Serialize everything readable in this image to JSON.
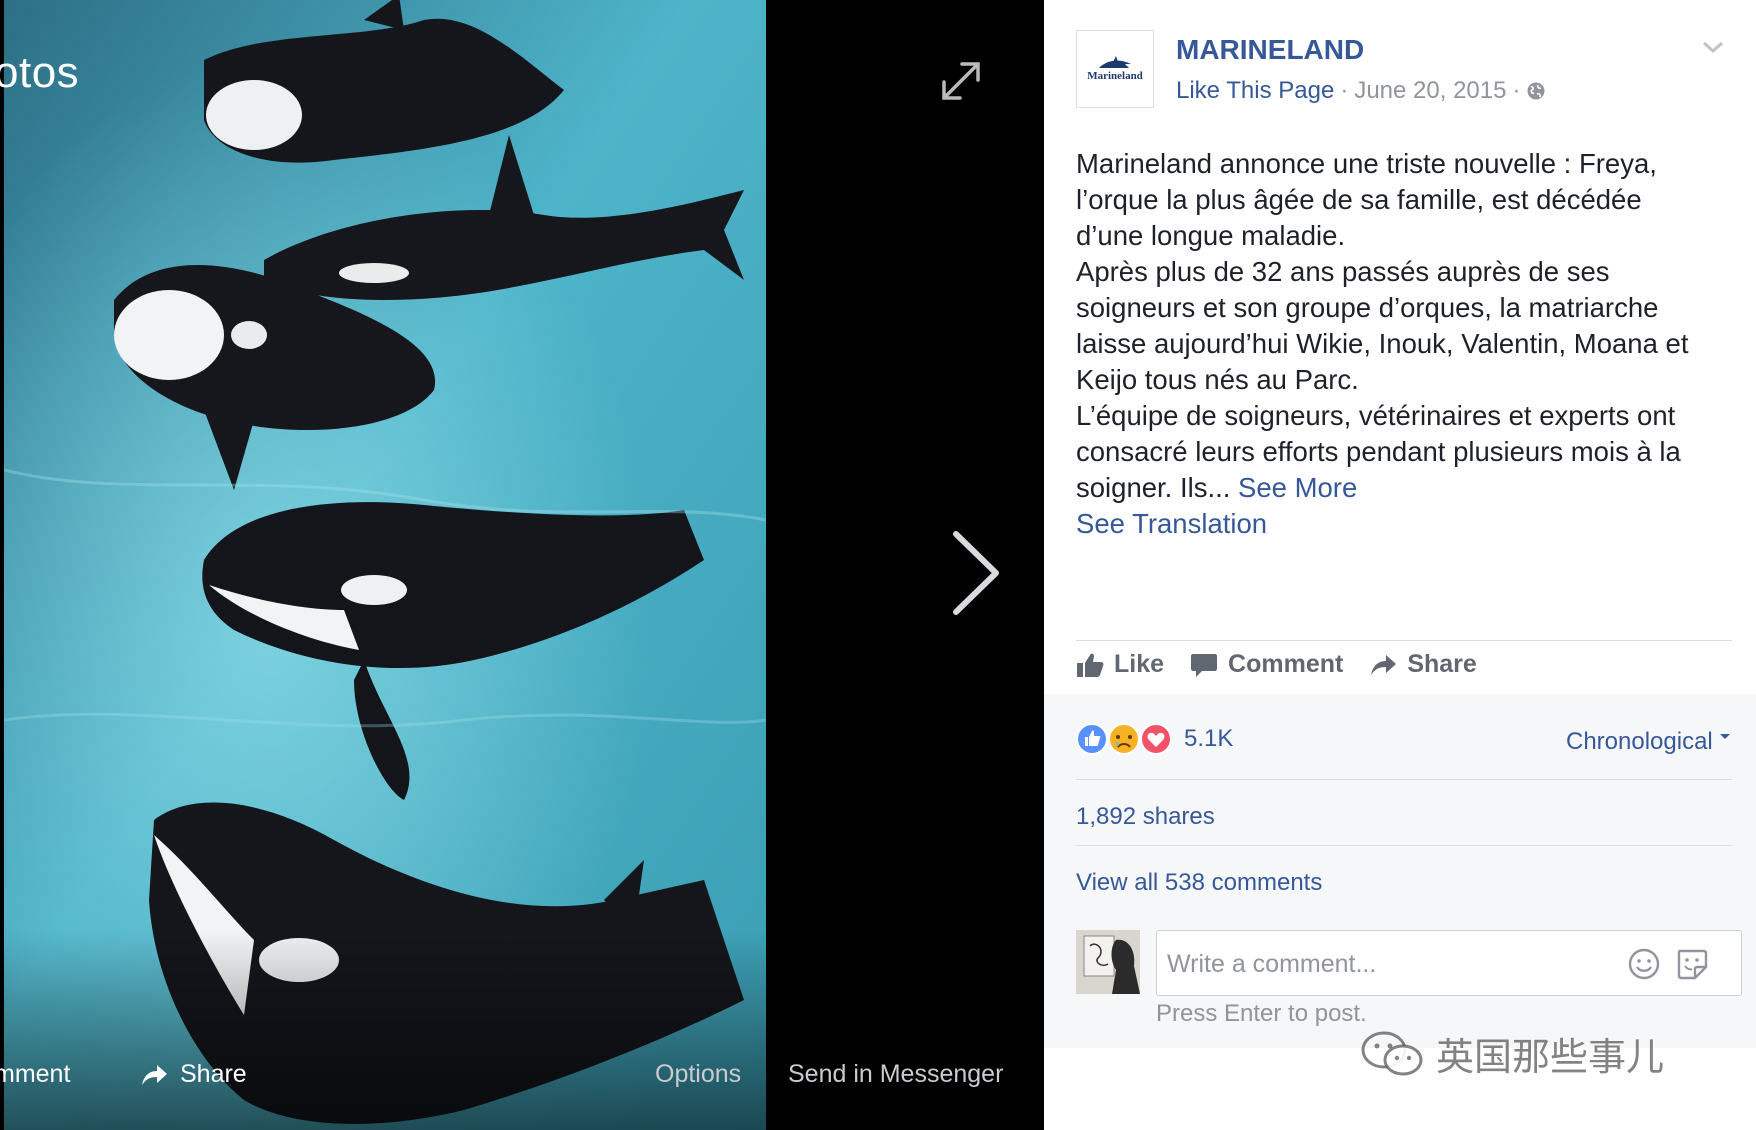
{
  "viewer": {
    "title": "otos",
    "bottom": {
      "comment_label": "mment",
      "share_label": "Share",
      "options_label": "Options",
      "messenger_label": "Send in Messenger"
    },
    "photo": {
      "description_icon": "orca-whales-photo"
    }
  },
  "post": {
    "page_name": "MARINELAND",
    "avatar_text": "Marineland",
    "like_page": "Like This Page",
    "separator": "·",
    "date": "June 20, 2015",
    "text_lines": [
      "Marineland annonce une triste nouvelle : Freya,",
      "l’orque la plus âgée de sa famille, est décédée",
      "d’une longue maladie.",
      "Après plus de 32 ans passés auprès de ses",
      "soigneurs et son groupe d’orques, la matriarche",
      "laisse aujourd’hui Wikie, Inouk, Valentin, Moana et",
      "Keijo tous nés au Parc.",
      "L’équipe de soigneurs, vétérinaires et experts ont",
      "consacré leurs efforts pendant plusieurs mois à la",
      "soigner. Ils..."
    ],
    "see_more": "See More",
    "see_translation": "See Translation",
    "actions": {
      "like": "Like",
      "comment": "Comment",
      "share": "Share"
    },
    "reaction_count": "5.1K",
    "sort": "Chronological",
    "shares": "1,892 shares",
    "view_all": "View all 538 comments",
    "comment_placeholder": "Write a comment...",
    "press_enter": "Press Enter to post."
  },
  "watermark": "英国那些事儿",
  "colors": {
    "link": "#365899",
    "muted": "#90949c",
    "text": "#1d2129",
    "like_blue": "#5890ff",
    "love_red": "#f25268",
    "sad_yellow": "#f7b125"
  }
}
